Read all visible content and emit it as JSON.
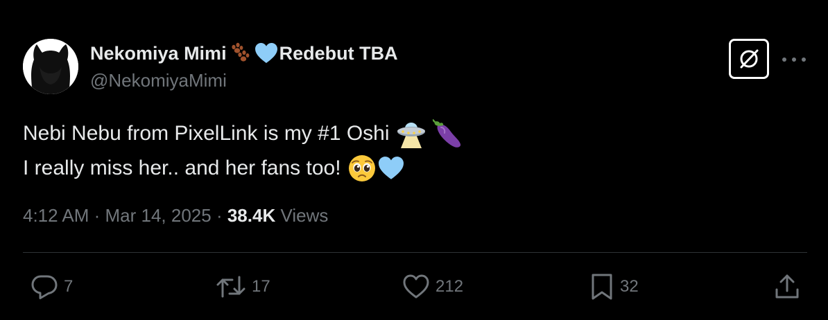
{
  "author": {
    "display_name_part1": "Nekomiya Mimi",
    "display_name_part2": "Redebut TBA",
    "handle": "@NekomiyaMimi"
  },
  "icons": {
    "avatar": "avatar-silhouette",
    "name_emoji_1": "paw-prints-icon",
    "name_emoji_2": "light-blue-heart-icon",
    "grok": "grok-icon",
    "more": "more-dots-icon",
    "text_emojis_line1": [
      "ufo-icon",
      "eggplant-icon"
    ],
    "text_emojis_line2": [
      "pleading-face-icon",
      "light-blue-heart-icon"
    ]
  },
  "tweet": {
    "line1": "Nebi Nebu from PixelLink is my #1 Oshi",
    "line2": "I really miss her.. and her fans too!"
  },
  "meta": {
    "time": "4:12 AM",
    "separator": " · ",
    "date": "Mar 14, 2025",
    "views_count": "38.4K",
    "views_label": "Views"
  },
  "actions": {
    "replies": "7",
    "reposts": "17",
    "likes": "212",
    "bookmarks": "32"
  },
  "colors": {
    "background": "#000000",
    "primary_text": "#e7e9ea",
    "secondary_text": "#71767b",
    "divider": "#2f3336",
    "heart_blue": "#8ecdf8"
  }
}
